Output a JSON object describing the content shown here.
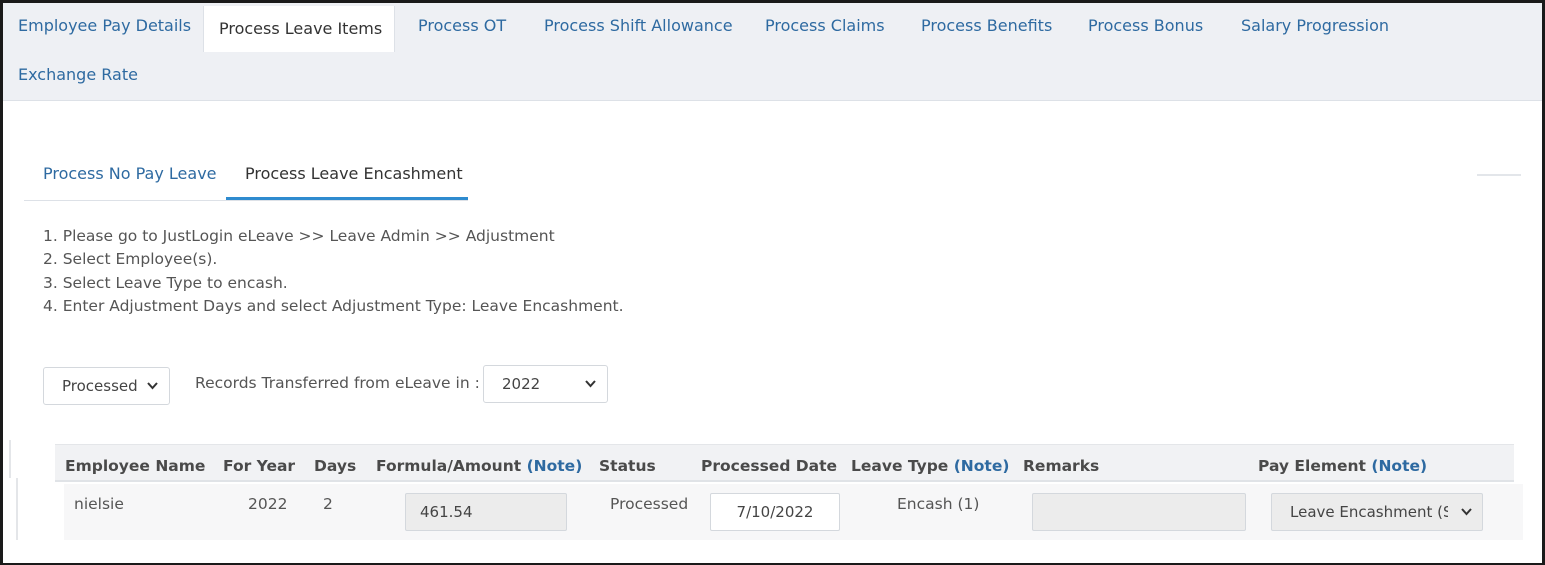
{
  "top_tabs": [
    {
      "label": "Employee Pay Details"
    },
    {
      "label": "Process Leave Items"
    },
    {
      "label": "Process OT"
    },
    {
      "label": "Process Shift Allowance"
    },
    {
      "label": "Process Claims"
    },
    {
      "label": "Process Benefits"
    },
    {
      "label": "Process Bonus"
    },
    {
      "label": "Salary Progression"
    },
    {
      "label": "Exchange Rate"
    }
  ],
  "sub_tabs": [
    {
      "label": "Process No Pay Leave"
    },
    {
      "label": "Process Leave Encashment"
    }
  ],
  "instructions": [
    "1. Please go to JustLogin eLeave >> Leave Admin >> Adjustment",
    "2. Select Employee(s).",
    "3. Select Leave Type to encash.",
    "4. Enter Adjustment Days and select Adjustment Type: Leave Encashment."
  ],
  "filters": {
    "status_value": "Processed",
    "records_label": "Records Transferred from eLeave in :",
    "year_value": "2022"
  },
  "table": {
    "columns": [
      {
        "label": "Employee Name",
        "note": ""
      },
      {
        "label": "For Year",
        "note": ""
      },
      {
        "label": "Days",
        "note": ""
      },
      {
        "label": "Formula/Amount",
        "note": "(Note)"
      },
      {
        "label": "Status",
        "note": ""
      },
      {
        "label": "Processed Date",
        "note": ""
      },
      {
        "label": "Leave Type",
        "note": "(Note)"
      },
      {
        "label": "Remarks",
        "note": ""
      },
      {
        "label": "Pay Element",
        "note": "(Note)"
      }
    ],
    "rows": [
      {
        "employee_name": "nielsie",
        "for_year": "2022",
        "days": "2",
        "formula_amount": "461.54",
        "status": "Processed",
        "processed_date": "7/10/2022",
        "leave_type": "Encash (1)",
        "remarks": "",
        "pay_element": "Leave Encashment (Sys"
      }
    ]
  }
}
